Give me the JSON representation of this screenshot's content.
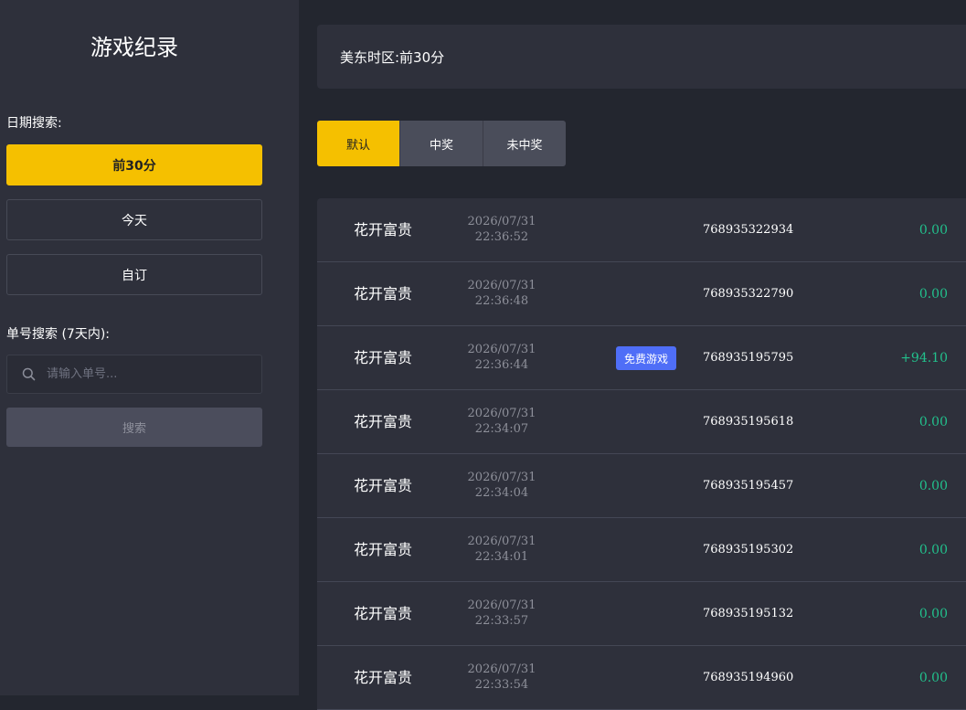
{
  "sidebar": {
    "title": "游戏纪录",
    "date_search_label": "日期搜索:",
    "date_buttons": [
      "前30分",
      "今天",
      "自订"
    ],
    "active_date": "前30分",
    "order_search_label": "单号搜索 (7天内):",
    "search_placeholder": "请输入单号...",
    "search_button": "搜索"
  },
  "timezone": {
    "label": "美东时区:前30分"
  },
  "filters": {
    "tabs": [
      "默认",
      "中奖",
      "未中奖"
    ],
    "active": "默认"
  },
  "records": [
    {
      "game": "花开富贵",
      "date": "2026/07/31",
      "time": "22:36:52",
      "badge": "",
      "order": "768935322934",
      "amount": "0.00"
    },
    {
      "game": "花开富贵",
      "date": "2026/07/31",
      "time": "22:36:48",
      "badge": "",
      "order": "768935322790",
      "amount": "0.00"
    },
    {
      "game": "花开富贵",
      "date": "2026/07/31",
      "time": "22:36:44",
      "badge": "免费游戏",
      "order": "768935195795",
      "amount": "+94.10"
    },
    {
      "game": "花开富贵",
      "date": "2026/07/31",
      "time": "22:34:07",
      "badge": "",
      "order": "768935195618",
      "amount": "0.00"
    },
    {
      "game": "花开富贵",
      "date": "2026/07/31",
      "time": "22:34:04",
      "badge": "",
      "order": "768935195457",
      "amount": "0.00"
    },
    {
      "game": "花开富贵",
      "date": "2026/07/31",
      "time": "22:34:01",
      "badge": "",
      "order": "768935195302",
      "amount": "0.00"
    },
    {
      "game": "花开富贵",
      "date": "2026/07/31",
      "time": "22:33:57",
      "badge": "",
      "order": "768935195132",
      "amount": "0.00"
    },
    {
      "game": "花开富贵",
      "date": "2026/07/31",
      "time": "22:33:54",
      "badge": "",
      "order": "768935194960",
      "amount": "0.00"
    }
  ],
  "colors": {
    "accent": "#f5c000",
    "win": "#22c08c",
    "badge": "#4f6ef7",
    "panel": "#2e303b",
    "background": "#23262f"
  },
  "icons": {
    "search": "search-icon"
  }
}
